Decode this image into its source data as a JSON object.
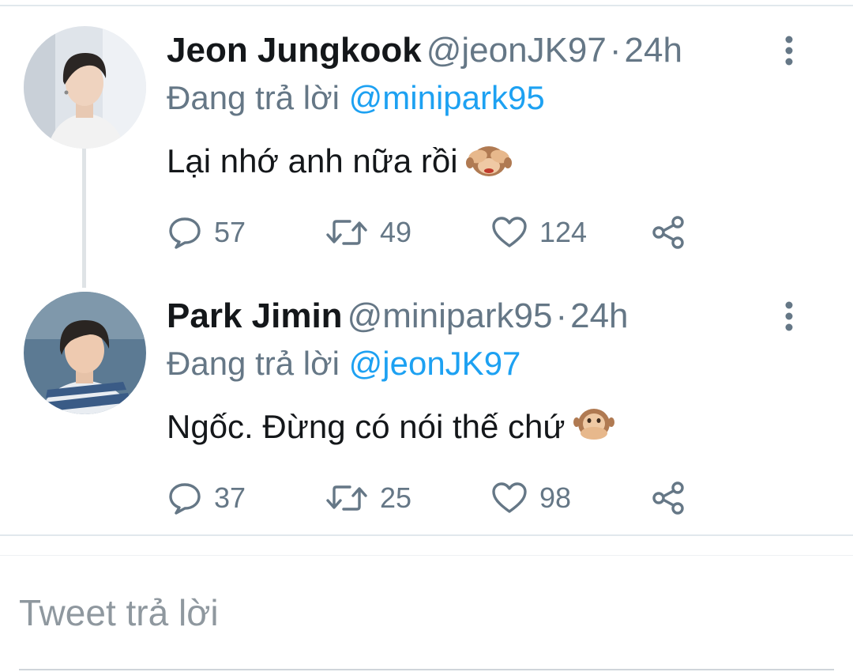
{
  "tweets": [
    {
      "name": "Jeon Jungkook",
      "handle": "@jeonJK97",
      "separator": "·",
      "time": "24h",
      "replying_prefix": "Đang trả lời",
      "replying_to": "@minipark95",
      "text": "Lại nhớ anh nữa rồi",
      "emoji": "see-no-evil-monkey",
      "counts": {
        "replies": "57",
        "retweets": "49",
        "likes": "124"
      }
    },
    {
      "name": "Park Jimin",
      "handle": "@minipark95",
      "separator": "·",
      "time": "24h",
      "replying_prefix": "Đang trả lời",
      "replying_to": "@jeonJK97",
      "text": "Ngốc. Đừng có nói thế chứ",
      "emoji": "speak-no-evil-monkey",
      "counts": {
        "replies": "37",
        "retweets": "25",
        "likes": "98"
      }
    }
  ],
  "reply_box": {
    "placeholder": "Tweet trả lời"
  },
  "colors": {
    "accent": "#1da1f2",
    "secondary_text": "#657786",
    "primary_text": "#14171a",
    "divider": "#e1e8ed"
  }
}
